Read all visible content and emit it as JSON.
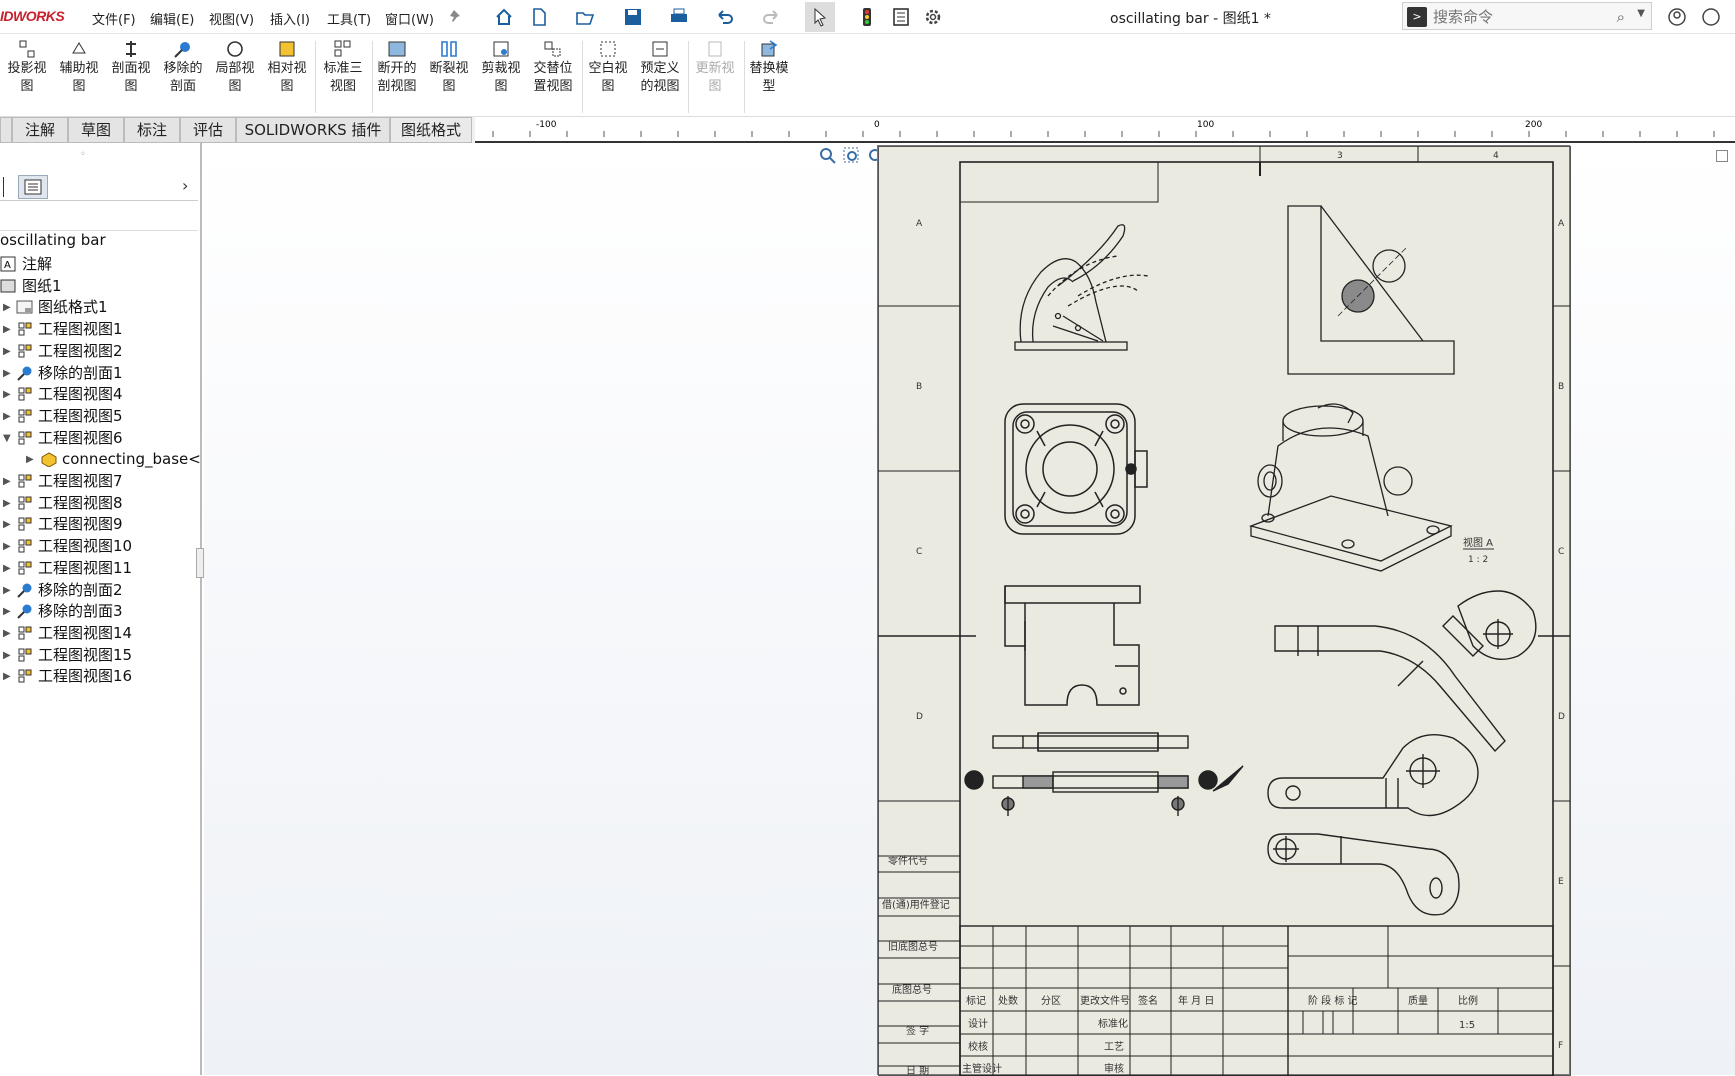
{
  "app": {
    "logo_text": "IDWORKS",
    "document_title": "oscillating bar - 图纸1 *"
  },
  "menu": [
    "文件(F)",
    "编辑(E)",
    "视图(V)",
    "插入(I)",
    "工具(T)",
    "窗口(W)"
  ],
  "search": {
    "placeholder": "搜索命令"
  },
  "ribbon": {
    "buttons": [
      {
        "l1": "投影视",
        "l2": "图"
      },
      {
        "l1": "辅助视",
        "l2": "图"
      },
      {
        "l1": "剖面视",
        "l2": "图"
      },
      {
        "l1": "移除的",
        "l2": "剖面"
      },
      {
        "l1": "局部视",
        "l2": "图"
      },
      {
        "l1": "相对视",
        "l2": "图"
      },
      {
        "l1": "标准三",
        "l2": "视图"
      },
      {
        "l1": "断开的",
        "l2": "剖视图"
      },
      {
        "l1": "断裂视",
        "l2": "图"
      },
      {
        "l1": "剪裁视",
        "l2": "图"
      },
      {
        "l1": "交替位",
        "l2": "置视图"
      },
      {
        "l1": "空白视",
        "l2": "图"
      },
      {
        "l1": "预定义",
        "l2": "的视图"
      },
      {
        "l1": "更新视",
        "l2": "图"
      },
      {
        "l1": "替换模",
        "l2": "型"
      }
    ]
  },
  "tabs": [
    "注解",
    "草图",
    "标注",
    "评估",
    "SOLIDWORKS 插件",
    "图纸格式"
  ],
  "ruler": {
    "labels": [
      "-100",
      "0",
      "100",
      "200"
    ]
  },
  "tree": {
    "root": "oscillating bar",
    "items": [
      {
        "label": "注解",
        "icon": "annotation-icon"
      },
      {
        "label": "图纸1",
        "icon": "sheet-icon"
      },
      {
        "label": "图纸格式1",
        "icon": "sheet-format-icon"
      },
      {
        "label": "工程图视图1",
        "icon": "view-icon"
      },
      {
        "label": "工程图视图2",
        "icon": "view-icon"
      },
      {
        "label": "移除的剖面1",
        "icon": "section-icon"
      },
      {
        "label": "工程图视图4",
        "icon": "view-icon"
      },
      {
        "label": "工程图视图5",
        "icon": "view-icon"
      },
      {
        "label": "工程图视图6",
        "icon": "view-icon"
      },
      {
        "label": "connecting_base<",
        "icon": "part-icon"
      },
      {
        "label": "工程图视图7",
        "icon": "view-icon"
      },
      {
        "label": "工程图视图8",
        "icon": "view-icon"
      },
      {
        "label": "工程图视图9",
        "icon": "view-icon"
      },
      {
        "label": "工程图视图10",
        "icon": "view-icon"
      },
      {
        "label": "工程图视图11",
        "icon": "view-icon"
      },
      {
        "label": "移除的剖面2",
        "icon": "section-icon"
      },
      {
        "label": "移除的剖面3",
        "icon": "section-icon"
      },
      {
        "label": "工程图视图14",
        "icon": "view-icon"
      },
      {
        "label": "工程图视图15",
        "icon": "view-icon"
      },
      {
        "label": "工程图视图16",
        "icon": "view-icon"
      }
    ]
  },
  "sheet": {
    "zone_rows": [
      "A",
      "B",
      "C",
      "D",
      "E",
      "F"
    ],
    "zone_cols": [
      "3",
      "4"
    ],
    "view_label": "视图 A",
    "view_scale": "1 : 2",
    "side_labels": [
      "零件代号",
      "借(通)用件登记",
      "旧底图总号",
      "底图总号",
      "签 字",
      "日 期"
    ],
    "title_headers": [
      "标记",
      "处数",
      "分区",
      "更改文件号",
      "签名",
      "年 月 日"
    ],
    "title_rows": [
      "设计",
      "校核",
      "主管设计"
    ],
    "title_cols2": [
      "标准化",
      "工艺",
      "审核"
    ],
    "stage": "阶 段 标 记",
    "mass": "质量",
    "ratio": "比例",
    "ratio_val": "1:5"
  }
}
